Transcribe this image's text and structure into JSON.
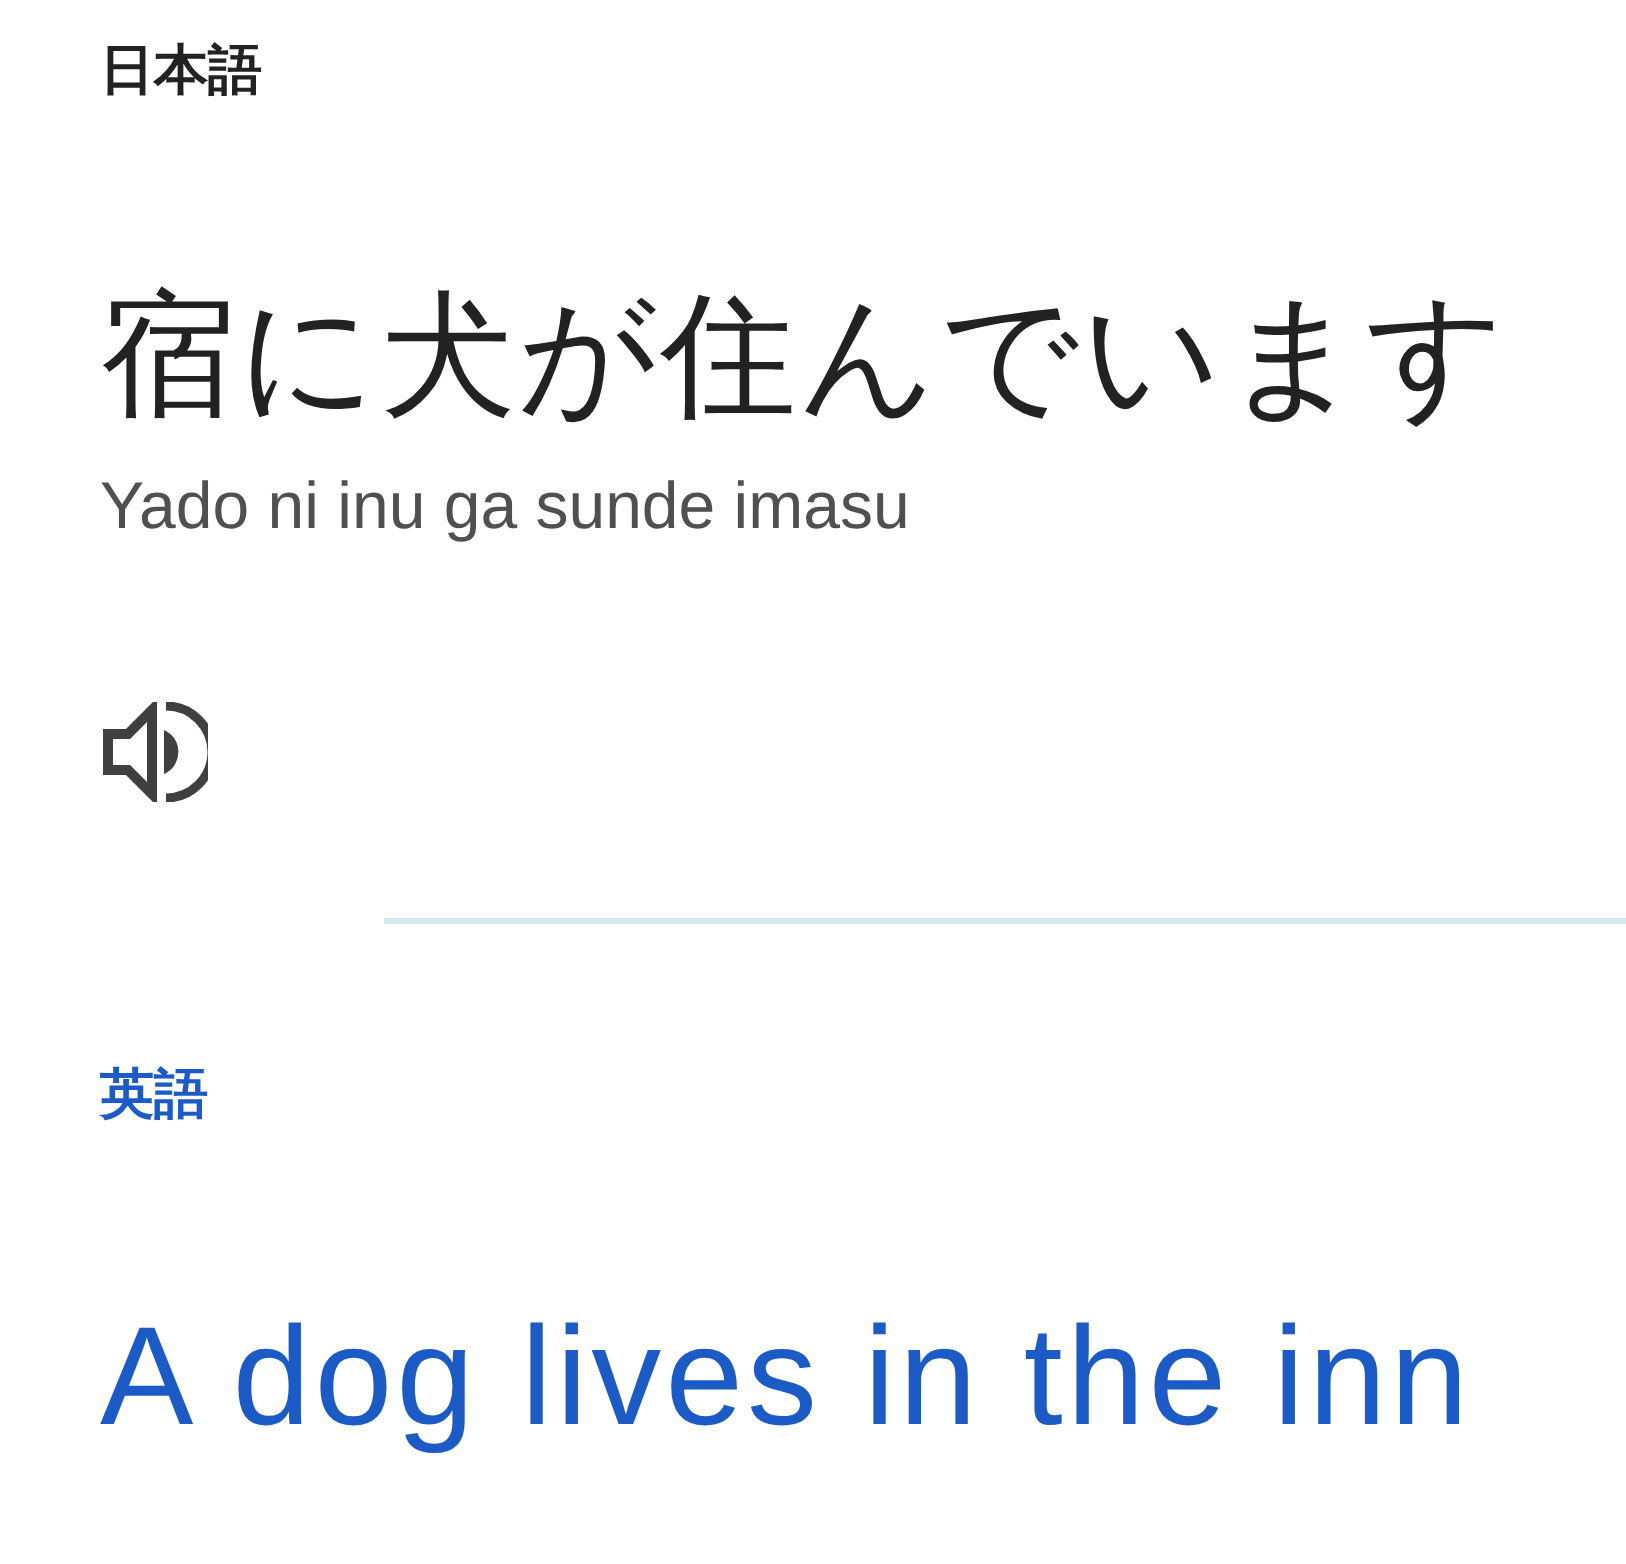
{
  "source": {
    "language": "日本語",
    "text": "宿に犬が住んでいます",
    "romanization": "Yado ni inu ga sunde imasu"
  },
  "target": {
    "language": "英語",
    "text": "A dog lives in the inn"
  }
}
